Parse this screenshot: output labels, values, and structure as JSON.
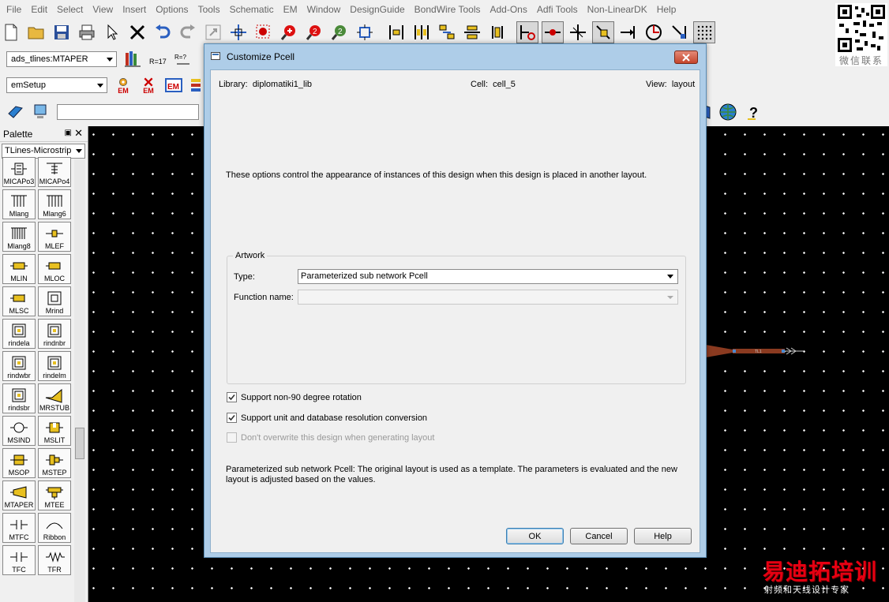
{
  "menubar": [
    "File",
    "Edit",
    "Select",
    "View",
    "Insert",
    "Options",
    "Tools",
    "Schematic",
    "EM",
    "Window",
    "DesignGuide",
    "BondWire Tools",
    "Add-Ons",
    "Adfi Tools",
    "Non-LinearDK",
    "Help"
  ],
  "toolbar": {
    "component_combo": "ads_tlines:MTAPER",
    "em_combo": "emSetup",
    "em_labels": [
      "EM",
      "EM",
      "EM"
    ]
  },
  "palette": {
    "title": "Palette",
    "library": "TLines-Microstrip",
    "items": [
      "MICAPo3",
      "MICAPo4",
      "Mlang",
      "Mlang6",
      "Mlang8",
      "MLEF",
      "MLIN",
      "MLOC",
      "MLSC",
      "Mrind",
      "rindela",
      "rindnbr",
      "rindwbr",
      "rindelm",
      "rindsbr",
      "MRSTUB",
      "MSIND",
      "MSLIT",
      "MSOP",
      "MSTEP",
      "MTAPER",
      "MTEE",
      "MTFC",
      "Ribbon",
      "TFC",
      "TFR"
    ]
  },
  "qr_text": "微信联系",
  "watermark": {
    "big": "易迪拓培训",
    "small": "射频和天线设计专家"
  },
  "dialog": {
    "title": "Customize Pcell",
    "library_label": "Library:",
    "library_value": "diplomatiki1_lib",
    "cell_label": "Cell:",
    "cell_value": "cell_5",
    "view_label": "View:",
    "view_value": "layout",
    "description": "These options control the appearance of instances of this design when this design is placed in another layout.",
    "artwork_legend": "Artwork",
    "type_label": "Type:",
    "type_value": "Parameterized sub network Pcell",
    "function_label": "Function name:",
    "function_value": "",
    "checkbox1": {
      "label": "Support non-90 degree rotation",
      "checked": true
    },
    "checkbox2": {
      "label": "Support unit and database resolution conversion",
      "checked": true
    },
    "checkbox3": {
      "label": "Don't overwrite this design when generating layout",
      "checked": false,
      "disabled": true
    },
    "pcell_description": "Parameterized sub network Pcell: The original layout is used as a template.  The parameters is evaluated and the new layout is adjusted based on the values.",
    "ok": "OK",
    "cancel": "Cancel",
    "help": "Help"
  }
}
